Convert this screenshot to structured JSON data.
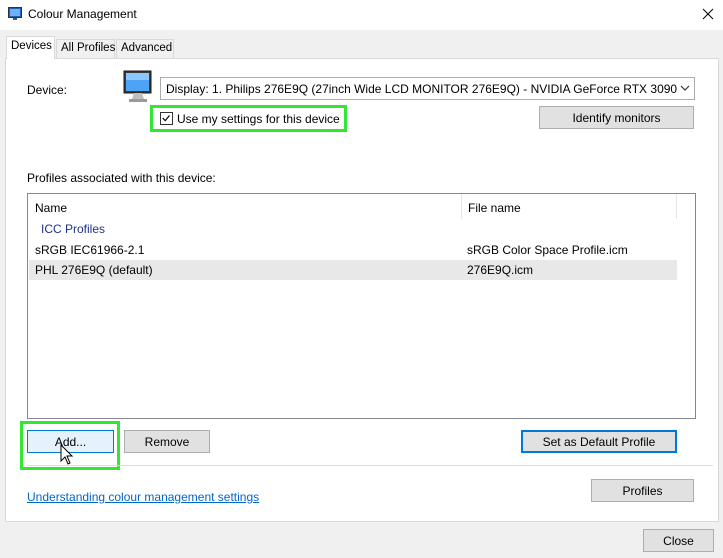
{
  "window": {
    "title": "Colour Management",
    "close_icon": "close-icon"
  },
  "tabs": [
    {
      "label": "Devices",
      "active": true
    },
    {
      "label": "All Profiles",
      "active": false
    },
    {
      "label": "Advanced",
      "active": false
    }
  ],
  "device": {
    "label": "Device:",
    "selected": "Display: 1. Philips 276E9Q (27inch Wide LCD MONITOR 276E9Q) - NVIDIA GeForce RTX 3090",
    "use_settings_label": "Use my settings for this device",
    "use_settings_checked": true,
    "identify_label": "Identify monitors"
  },
  "profiles": {
    "section_label": "Profiles associated with this device:",
    "columns": [
      "Name",
      "File name"
    ],
    "group_label": "ICC Profiles",
    "rows": [
      {
        "name": "sRGB IEC61966-2.1",
        "file": "sRGB Color Space Profile.icm"
      },
      {
        "name": "PHL 276E9Q (default)",
        "file": "276E9Q.icm"
      }
    ],
    "selected_row": 1
  },
  "buttons": {
    "add": "Add...",
    "remove": "Remove",
    "set_default": "Set as Default Profile",
    "profiles": "Profiles",
    "close": "Close"
  },
  "footer": {
    "link": "Understanding colour management settings"
  },
  "colors": {
    "highlight": "#33e633",
    "accent": "#0078d7",
    "link": "#0066cc"
  }
}
